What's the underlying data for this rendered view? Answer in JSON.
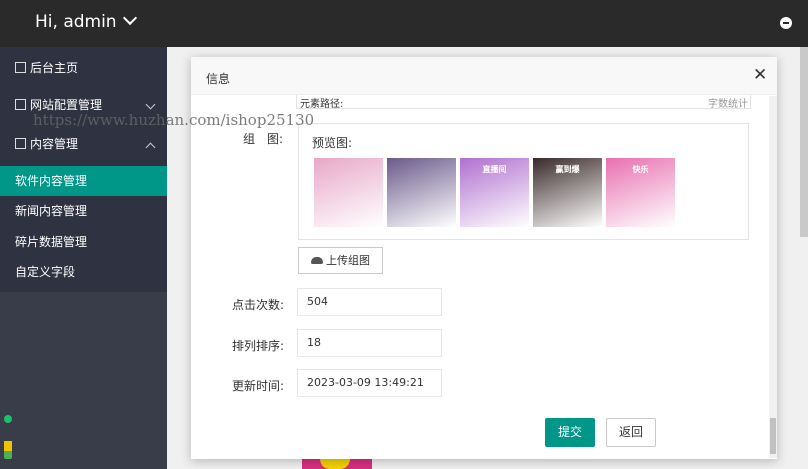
{
  "header": {
    "greeting": "Hi, admin"
  },
  "sidebar": {
    "items": [
      {
        "label": "后台主页",
        "icon": "home-icon"
      },
      {
        "label": "网站配置管理",
        "icon": "config-icon"
      },
      {
        "label": "内容管理",
        "icon": "content-icon"
      }
    ],
    "sub_items": [
      {
        "label": "软件内容管理",
        "active": true
      },
      {
        "label": "新闻内容管理",
        "active": false
      },
      {
        "label": "碎片数据管理",
        "active": false
      },
      {
        "label": "自定义字段",
        "active": false
      }
    ]
  },
  "watermark": "https://www.huzhan.com/ishop25130",
  "modal": {
    "title": "信息",
    "path_label": "元素路径:",
    "word_count_label": "字数统计",
    "gallery_label": "组　图:",
    "preview_label": "预览图:",
    "thumbnails": [
      {
        "caption": "",
        "color": "#e8a8c8"
      },
      {
        "caption": "",
        "color": "#6a5a8a"
      },
      {
        "caption": "直播间",
        "color": "#b070d0"
      },
      {
        "caption": "赢到爆",
        "color": "#3a2a2a"
      },
      {
        "caption": "快乐",
        "color": "#e870b0"
      }
    ],
    "upload_label": "上传组图",
    "clicks_label": "点击次数:",
    "clicks_value": "504",
    "sort_label": "排列排序:",
    "sort_value": "18",
    "updated_label": "更新时间:",
    "updated_value": "2023-03-09 13:49:21",
    "submit_label": "提交",
    "back_label": "返回"
  },
  "colors": {
    "accent": "#009688",
    "topbar": "#2a2a2a",
    "sidebar": "#393d49"
  }
}
